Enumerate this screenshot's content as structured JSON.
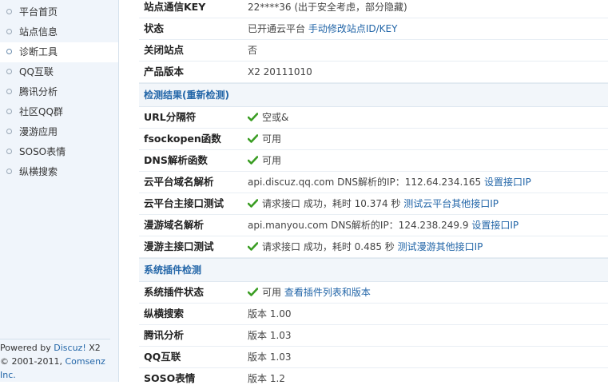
{
  "sidebar": {
    "items": [
      {
        "label": "平台首页"
      },
      {
        "label": "站点信息"
      },
      {
        "label": "诊断工具"
      },
      {
        "label": "QQ互联"
      },
      {
        "label": "腾讯分析"
      },
      {
        "label": "社区QQ群"
      },
      {
        "label": "漫游应用"
      },
      {
        "label": "SOSO表情"
      },
      {
        "label": "纵横搜索"
      }
    ],
    "footer": {
      "powered_prefix": "Powered by ",
      "powered_link": "Discuz!",
      "powered_version": " X2",
      "copyright_prefix": "© 2001-2011, ",
      "copyright_link": "Comsenz Inc."
    }
  },
  "rows_top": [
    {
      "label": "站点通信KEY",
      "value": "22****36 (出于安全考虑，部分隐藏)"
    },
    {
      "label": "状态",
      "value": "已开通云平台",
      "link": "手动修改站点ID/KEY"
    },
    {
      "label": "关闭站点",
      "value": "否"
    },
    {
      "label": "产品版本",
      "value": "X2 20111010"
    }
  ],
  "section_detect": {
    "title": "检测结果(重新检测)"
  },
  "rows_detect": [
    {
      "label": "URL分隔符",
      "value": "空或&"
    },
    {
      "label": "fsockopen函数",
      "value": "可用"
    },
    {
      "label": "DNS解析函数",
      "value": "可用"
    },
    {
      "label": "云平台域名解析",
      "value": "api.discuz.qq.com DNS解析的IP：112.64.234.165",
      "link": "设置接口IP"
    },
    {
      "label": "云平台主接口测试",
      "value": "请求接口 成功，耗时 10.374 秒",
      "link": "测试云平台其他接口IP"
    },
    {
      "label": "漫游域名解析",
      "value": "api.manyou.com DNS解析的IP：124.238.249.9",
      "link": "设置接口IP"
    },
    {
      "label": "漫游主接口测试",
      "value": "请求接口 成功，耗时 0.485 秒",
      "link": "测试漫游其他接口IP"
    }
  ],
  "section_plugins": {
    "title": "系统插件检测"
  },
  "rows_plugins": [
    {
      "label": "系统插件状态",
      "value": "可用",
      "link": "查看插件列表和版本"
    },
    {
      "label": "纵横搜索",
      "value": "版本 1.00"
    },
    {
      "label": "腾讯分析",
      "value": "版本 1.03"
    },
    {
      "label": "QQ互联",
      "value": "版本 1.03"
    },
    {
      "label": "SOSO表情",
      "value": "版本 1.2"
    }
  ],
  "colors": {
    "link": "#2366a8",
    "check": "#3a9d23",
    "sidebar_bg": "#f0f5fb"
  }
}
